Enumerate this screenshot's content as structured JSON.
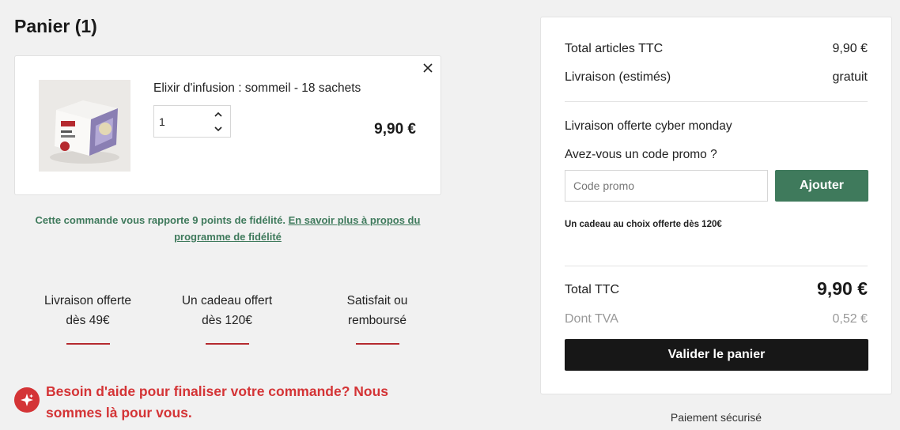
{
  "cart": {
    "title": "Panier (1)",
    "item": {
      "name": "Elixir d'infusion : sommeil - 18 sachets",
      "quantity": "1",
      "price": "9,90 €"
    },
    "loyalty_text": "Cette commande vous rapporte 9 points de fidélité.",
    "loyalty_link": "En savoir plus à propos du programme de fidélité"
  },
  "features": [
    {
      "line1": "Livraison offerte",
      "line2": "dès 49€"
    },
    {
      "line1": "Un cadeau offert",
      "line2": "dès 120€"
    },
    {
      "line1": "Satisfait ou",
      "line2": "remboursé"
    }
  ],
  "help": {
    "text": "Besoin d'aide pour finaliser votre commande? Nous sommes là pour vous."
  },
  "summary": {
    "subtotal_label": "Total articles TTC",
    "subtotal_value": "9,90 €",
    "shipping_label": "Livraison (estimés)",
    "shipping_value": "gratuit",
    "promo_banner": "Livraison offerte cyber monday",
    "promo_question": "Avez-vous un code promo ?",
    "promo_placeholder": "Code promo",
    "promo_button": "Ajouter",
    "gift_note": "Un cadeau au choix offerte dès 120€",
    "total_label": "Total TTC",
    "total_value": "9,90 €",
    "vat_label": "Dont TVA",
    "vat_value": "0,52 €",
    "validate_button": "Valider le panier",
    "secure_text": "Paiement sécurisé"
  },
  "colors": {
    "accent_green": "#3f7a5c",
    "accent_red": "#d43436",
    "underline_red": "#b52a2f",
    "button_dark": "#171717"
  },
  "icons": {
    "remove": "close-icon",
    "qty_up": "chevron-up-icon",
    "qty_down": "chevron-down-icon",
    "help": "sparkle-icon"
  }
}
